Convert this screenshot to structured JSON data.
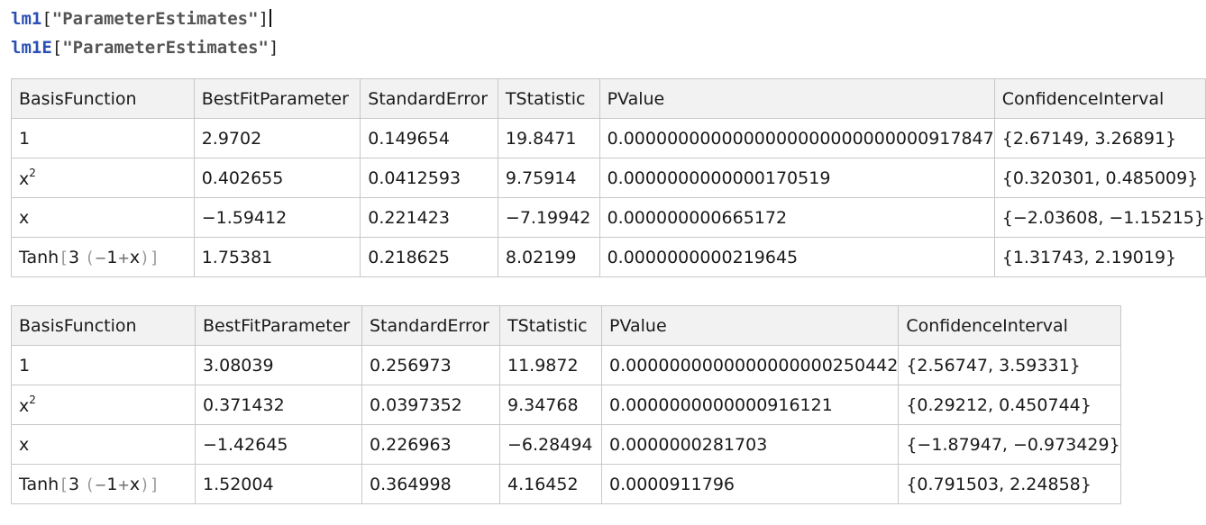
{
  "inputs": [
    {
      "symbol": "lm1",
      "open": "[",
      "string": "\"ParameterEstimates\"",
      "close": "]"
    },
    {
      "symbol": "lm1E",
      "open": "[",
      "string": "\"ParameterEstimates\"",
      "close": "]"
    }
  ],
  "tables": [
    {
      "headers": [
        "BasisFunction",
        "BestFitParameter",
        "StandardError",
        "TStatistic",
        "PValue",
        "ConfidenceInterval"
      ],
      "rows": [
        [
          "1",
          "2.9702",
          "0.149654",
          "19.8471",
          "0.0000000000000000000000000000917847",
          "{2.67149, 3.26891}"
        ],
        [
          "x",
          "0.402655",
          "0.0412593",
          "9.75914",
          "0.0000000000000170519",
          "{0.320301, 0.485009}"
        ],
        [
          "x",
          "−1.59412",
          "0.221423",
          "−7.19942",
          "0.000000000665172",
          "{−2.03608, −1.15215}"
        ],
        [
          "Tanh",
          "1.75381",
          "0.218625",
          "8.02199",
          "0.0000000000219645",
          "{1.31743, 2.19019}"
        ]
      ]
    },
    {
      "headers": [
        "BasisFunction",
        "BestFitParameter",
        "StandardError",
        "TStatistic",
        "PValue",
        "ConfidenceInterval"
      ],
      "rows": [
        [
          "1",
          "3.08039",
          "0.256973",
          "11.9872",
          "0.0000000000000000000250442",
          "{2.56747, 3.59331}"
        ],
        [
          "x",
          "0.371432",
          "0.0397352",
          "9.34768",
          "0.0000000000000916121",
          "{0.29212, 0.450744}"
        ],
        [
          "x",
          "−1.42645",
          "0.226963",
          "−6.28494",
          "0.0000000281703",
          "{−1.87947, −0.973429}"
        ],
        [
          "Tanh",
          "1.52004",
          "0.364998",
          "4.16452",
          "0.0000911796",
          "{0.791503, 2.24858}"
        ]
      ]
    }
  ],
  "math": {
    "square_exponent": "2",
    "tanh_open": "[",
    "tanh_close": "]",
    "tanh_coeff": "3",
    "paren_open": "(",
    "paren_close": ")",
    "minus": "−",
    "one": "1",
    "plus": "+",
    "x": "x"
  }
}
